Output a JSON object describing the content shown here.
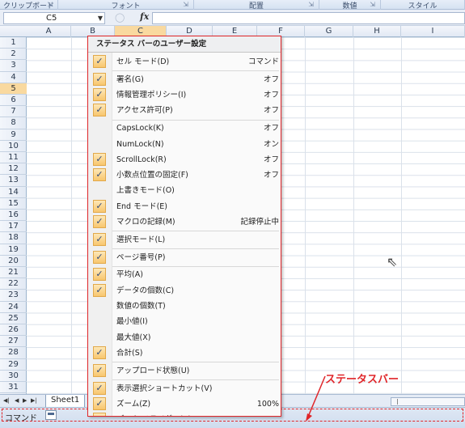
{
  "ribbon_groups": [
    {
      "label": "クリップボード",
      "w": 72
    },
    {
      "label": "フォント",
      "w": 168
    },
    {
      "label": "配置",
      "w": 155
    },
    {
      "label": "数値",
      "w": 76
    },
    {
      "label": "スタイル",
      "w": 104
    }
  ],
  "formula_bar": {
    "name_box": "C5",
    "fx": "fx"
  },
  "columns": [
    "A",
    "B",
    "C",
    "D",
    "E",
    "F",
    "G",
    "H",
    "I"
  ],
  "rows": [
    "1",
    "2",
    "3",
    "4",
    "5",
    "6",
    "7",
    "8",
    "9",
    "10",
    "11",
    "12",
    "13",
    "14",
    "15",
    "16",
    "17",
    "18",
    "19",
    "20",
    "21",
    "22",
    "23",
    "24",
    "25",
    "26",
    "27",
    "28",
    "29",
    "30",
    "31"
  ],
  "selected_cell": {
    "column": "C",
    "row": "5"
  },
  "context_menu": {
    "title": "ステータス バーのユーザー設定",
    "items": [
      {
        "label": "セル モード(D)",
        "value": "コマンド",
        "checked": true
      },
      {
        "label": "署名(G)",
        "value": "オフ",
        "checked": true
      },
      {
        "label": "情報管理ポリシー(I)",
        "value": "オフ",
        "checked": true
      },
      {
        "label": "アクセス許可(P)",
        "value": "オフ",
        "checked": true
      },
      {
        "label": "CapsLock(K)",
        "value": "オフ",
        "checked": false
      },
      {
        "label": "NumLock(N)",
        "value": "オン",
        "checked": false
      },
      {
        "label": "ScrollLock(R)",
        "value": "オフ",
        "checked": true
      },
      {
        "label": "小数点位置の固定(F)",
        "value": "オフ",
        "checked": true
      },
      {
        "label": "上書きモード(O)",
        "value": "",
        "checked": false
      },
      {
        "label": "End モード(E)",
        "value": "",
        "checked": true
      },
      {
        "label": "マクロの記録(M)",
        "value": "記録停止中",
        "checked": true
      },
      {
        "label": "選択モード(L)",
        "value": "",
        "checked": true
      },
      {
        "label": "ページ番号(P)",
        "value": "",
        "checked": true
      },
      {
        "label": "平均(A)",
        "value": "",
        "checked": true
      },
      {
        "label": "データの個数(C)",
        "value": "",
        "checked": true
      },
      {
        "label": "数値の個数(T)",
        "value": "",
        "checked": false
      },
      {
        "label": "最小値(I)",
        "value": "",
        "checked": false
      },
      {
        "label": "最大値(X)",
        "value": "",
        "checked": false
      },
      {
        "label": "合計(S)",
        "value": "",
        "checked": true
      },
      {
        "label": "アップロード状態(U)",
        "value": "",
        "checked": true
      },
      {
        "label": "表示選択ショートカット(V)",
        "value": "",
        "checked": true
      },
      {
        "label": "ズーム(Z)",
        "value": "100%",
        "checked": true
      },
      {
        "label": "ズーム スライダー(Z)",
        "value": "",
        "checked": true
      }
    ]
  },
  "sheet_tabs": {
    "active": "Sheet1"
  },
  "status_bar": {
    "mode": "コマンド"
  },
  "annotation": {
    "label": "ステータスバー"
  },
  "check_glyph": "✓",
  "colors": {
    "highlight": "#e0262a",
    "selected_header": "#f9d99f"
  }
}
